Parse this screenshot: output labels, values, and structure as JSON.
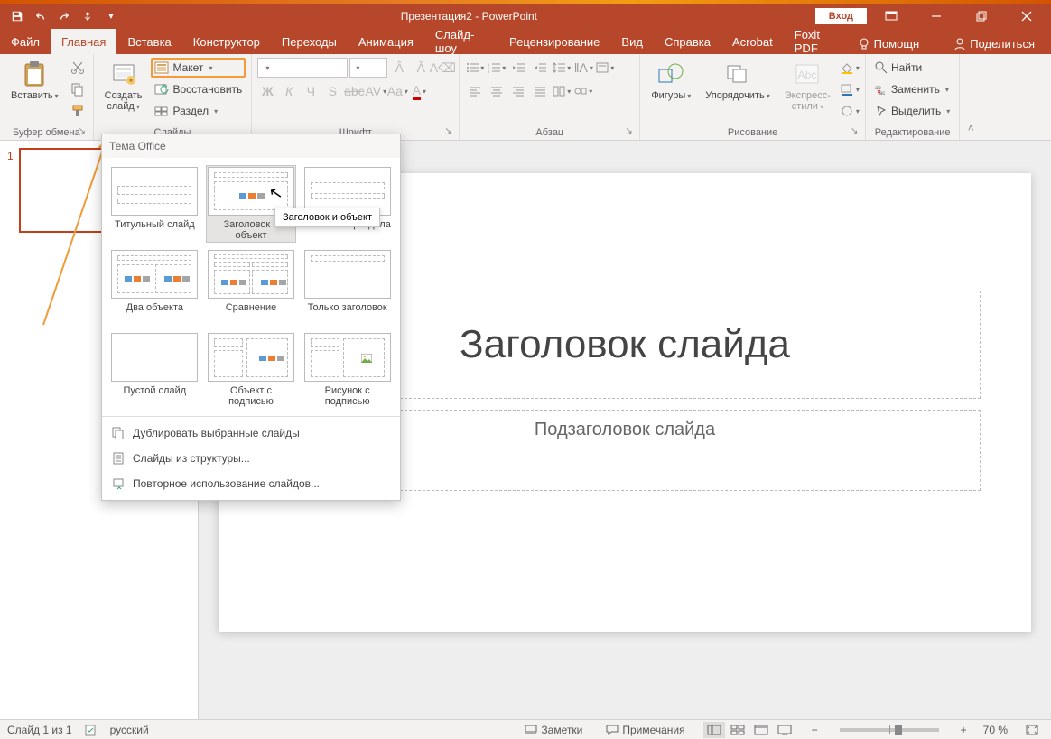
{
  "colors": {
    "accent": "#b7472a",
    "highlight": "#f19c38"
  },
  "titlebar": {
    "title": "Презентация2  -  PowerPoint",
    "signin": "Вход"
  },
  "tabs": {
    "file": "Файл",
    "home": "Главная",
    "insert": "Вставка",
    "design": "Конструктор",
    "transitions": "Переходы",
    "animations": "Анимация",
    "slideshow": "Слайд-шоу",
    "review": "Рецензирование",
    "view": "Вид",
    "help": "Справка",
    "acrobat": "Acrobat",
    "foxit": "Foxit PDF",
    "tellme": "Помощн",
    "share": "Поделиться"
  },
  "ribbon": {
    "clipboard": {
      "paste": "Вставить",
      "label": "Буфер обмена"
    },
    "slides": {
      "new_slide": "Создать\nслайд",
      "layout": "Макет",
      "reset": "Восстановить",
      "section": "Раздел",
      "label": "Слайды"
    },
    "font": {
      "label": "Шрифт"
    },
    "paragraph": {
      "label": "Абзац"
    },
    "drawing": {
      "shapes": "Фигуры",
      "arrange": "Упорядочить",
      "quick_styles": "Экспресс-\nстили",
      "label": "Рисование"
    },
    "editing": {
      "find": "Найти",
      "replace": "Заменить",
      "select": "Выделить",
      "label": "Редактирование"
    }
  },
  "gallery": {
    "header": "Тема Office",
    "items": [
      "Титульный слайд",
      "Заголовок и объект",
      "Заголовок раздела",
      "Два объекта",
      "Сравнение",
      "Только заголовок",
      "Пустой слайд",
      "Объект с подписью",
      "Рисунок с подписью"
    ],
    "footer": {
      "duplicate": "Дублировать выбранные слайды",
      "outline": "Слайды из структуры...",
      "reuse": "Повторное использование слайдов..."
    },
    "tooltip": "Заголовок и объект"
  },
  "slide": {
    "title_placeholder": "Заголовок слайда",
    "subtitle_placeholder": "Подзаголовок слайда"
  },
  "thumbnail": {
    "number": "1"
  },
  "status": {
    "slide_counter": "Слайд 1 из 1",
    "language": "русский",
    "notes": "Заметки",
    "comments": "Примечания",
    "zoom": "70 %"
  }
}
